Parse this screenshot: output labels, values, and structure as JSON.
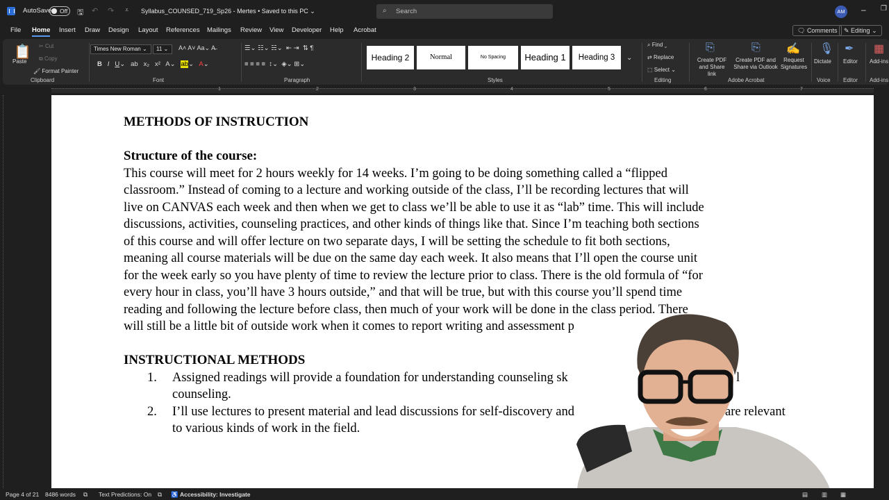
{
  "titlebar": {
    "autosave_label": "AutoSave",
    "autosave_state": "Off",
    "doc_title": "Syllabus_COUNSED_719_Sp26 - Mertes • Saved to this PC ⌄",
    "search_placeholder": "Search",
    "avatar_initials": "AM"
  },
  "menu": {
    "tabs": [
      "File",
      "Home",
      "Insert",
      "Draw",
      "Design",
      "Layout",
      "References",
      "Mailings",
      "Review",
      "View",
      "Developer",
      "Help",
      "Acrobat"
    ],
    "active": "Home",
    "comments_label": "Comments",
    "editing_label": "Editing ⌄"
  },
  "ribbon": {
    "clipboard": {
      "paste": "Paste",
      "cut": "Cut",
      "copy": "Copy",
      "format_painter": "Format Painter",
      "label": "Clipboard"
    },
    "font": {
      "family": "Times New Roman",
      "size": "11",
      "label": "Font"
    },
    "paragraph": {
      "label": "Paragraph"
    },
    "styles": {
      "items": [
        "Heading 2",
        "Normal",
        "No Spacing",
        "Heading 1",
        "Heading 3"
      ],
      "label": "Styles"
    },
    "editing": {
      "find": "Find",
      "replace": "Replace",
      "select": "Select",
      "label": "Editing"
    },
    "acrobat": {
      "create_pdf_link": "Create PDF and Share link",
      "create_pdf_outlook": "Create PDF and Share via Outlook",
      "request_signatures": "Request Signatures",
      "label": "Adobe Acrobat"
    },
    "voice": {
      "dictate": "Dictate",
      "label": "Voice"
    },
    "editor": {
      "editor": "Editor",
      "label": "Editor"
    },
    "addins": {
      "addins": "Add-ins",
      "label": "Add-ins"
    }
  },
  "ruler": {
    "numbers": [
      "1",
      "2",
      "3",
      "4",
      "5",
      "6",
      "7"
    ]
  },
  "document": {
    "heading1": "METHODS OF INSTRUCTION",
    "heading2": "Structure of the course:",
    "para_lines": [
      "This course will meet for 2 hours weekly for 14 weeks.  I’m going to be doing something called a “flipped",
      "classroom.”  Instead of coming to a lecture and working outside of the class, I’ll be recording lectures that will",
      "live on CANVAS each week and then when we get to class we’ll be able to use it as “lab” time.  This will include",
      "discussions, activities, counseling practices, and other kinds of things like that.  Since I’m teaching both sections",
      "of this course and will offer lecture on two separate days, I will be setting the schedule to fit both sections,",
      "meaning all course materials will be due on the same day each week. It also means that I’ll open the course unit",
      "for the week early so you have plenty of time to review the lecture prior to class.  There is the old formula of “for",
      "every hour in class, you’ll have 3 hours outside,” and that will be true, but with this course you’ll spend time",
      "reading and following the lecture before class, then much of your work will be done in the class period.  There",
      "will still be a little bit of outside work when it comes to report writing and assessment p"
    ],
    "heading3": "INSTRUCTIONAL METHODS",
    "list": [
      {
        "num": "1.",
        "lines": [
          "Assigned readings will provide a foundation for understanding counseling sk",
          "counseling."
        ],
        "tail": "l"
      },
      {
        "num": "2.",
        "lines": [
          "I’ll use lectures to present material and lead discussions for self-discovery and",
          "to various kinds of work in the field."
        ],
        "tail": "are relevant"
      }
    ]
  },
  "statusbar": {
    "page": "Page 4 of 21",
    "words": "8486 words",
    "predictions": "Text Predictions: On",
    "accessibility": "Accessibility: Investigate"
  },
  "colors": {
    "accent": "#5a9bf0",
    "word_blue": "#2b6cd6"
  }
}
